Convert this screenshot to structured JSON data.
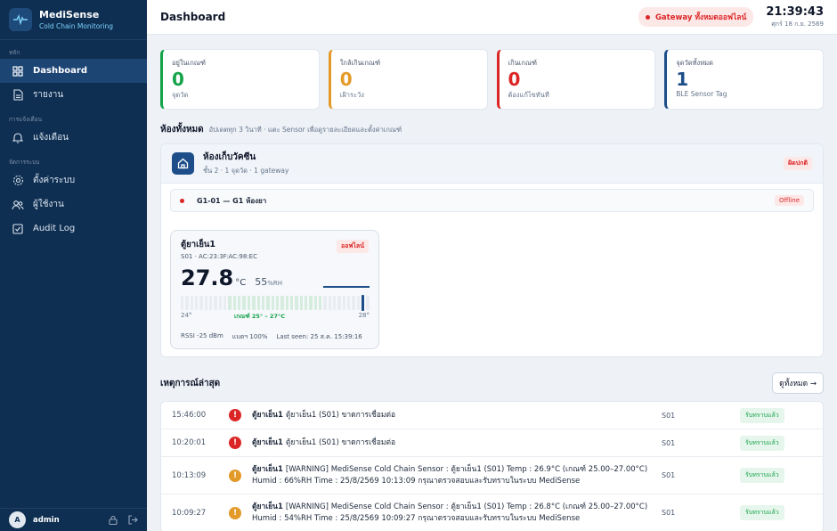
{
  "brand": {
    "name": "MediSense",
    "subtitle": "Cold Chain Monitoring"
  },
  "sidebar": {
    "sections": [
      "หลัก",
      "การแจ้งเตือน",
      "จัดการระบบ"
    ],
    "items": [
      {
        "label": "Dashboard",
        "icon": "grid-icon"
      },
      {
        "label": "รายงาน",
        "icon": "document-icon"
      },
      {
        "label": "แจ้งเตือน",
        "icon": "bell-icon"
      },
      {
        "label": "ตั้งค่าระบบ",
        "icon": "gear-icon"
      },
      {
        "label": "ผู้ใช้งาน",
        "icon": "users-icon"
      },
      {
        "label": "Audit Log",
        "icon": "checkbox-icon"
      }
    ]
  },
  "user": {
    "initial": "A",
    "name": "admin"
  },
  "header": {
    "title": "Dashboard",
    "gateway_status": "Gateway ทั้งหมดออฟไลน์",
    "time": "21:39:43",
    "date": "ศุกร์ 18 ก.ย. 2569"
  },
  "stats": [
    {
      "label": "อยู่ในเกณฑ์",
      "value": "0",
      "sub": "จุดวัด",
      "color": "#16a34a"
    },
    {
      "label": "ใกล้เกินเกณฑ์",
      "value": "0",
      "sub": "เฝ้าระวัง",
      "color": "#e39a29"
    },
    {
      "label": "เกินเกณฑ์",
      "value": "0",
      "sub": "ต้องแก้ไขทันที",
      "color": "#dc2626"
    },
    {
      "label": "จุดวัดทั้งหมด",
      "value": "1",
      "sub": "BLE Sensor Tag",
      "color": "#1d4e89"
    }
  ],
  "rooms_section": {
    "title": "ห้องทั้งหมด",
    "note": "อัปเดตทุก 3 วินาที · แตะ Sensor เพื่อดูรายละเอียดและตั้งค่าเกณฑ์"
  },
  "room": {
    "name": "ห้องเก็บวัคซีน",
    "sub": "ชั้น 2 · 1 จุดวัด · 1 gateway",
    "status": "ผิดปกติ",
    "gateway": {
      "name": "G1-01 — G1 ห้องยา",
      "status": "Offline"
    },
    "sensor": {
      "name": "ตู้ยาเย็น1",
      "id": "S01 · AC:23:3F:AC:98:EC",
      "status": "ออฟไลน์",
      "temp": "27.8",
      "temp_unit": "°C",
      "humidity": "55",
      "humidity_unit": "%RH",
      "range_min": "24°",
      "range_max": "28°",
      "range_label": "เกณฑ์ 25° – 27°C",
      "rssi": "RSSI -25 dBm",
      "battery": "แบตฯ 100%",
      "last_seen": "Last seen: 25 ส.ค. 15:39:16"
    }
  },
  "events_section": {
    "title": "เหตุการณ์ล่าสุด",
    "see_all": "ดูทั้งหมด →"
  },
  "events": [
    {
      "time": "15:46:00",
      "level": "critical",
      "device": "ตู้ยาเย็น1",
      "message": "ตู้ยาเย็น1 (S01) ขาดการเชื่อมต่อ",
      "message2": "",
      "sensor": "S01",
      "status": "รับทราบแล้ว"
    },
    {
      "time": "10:20:01",
      "level": "critical",
      "device": "ตู้ยาเย็น1",
      "message": "ตู้ยาเย็น1 (S01) ขาดการเชื่อมต่อ",
      "message2": "",
      "sensor": "S01",
      "status": "รับทราบแล้ว"
    },
    {
      "time": "10:13:09",
      "level": "warning",
      "device": "ตู้ยาเย็น1",
      "message": "[WARNING] MediSense Cold Chain Sensor : ตู้ยาเย็น1 (S01) Temp : 26.9°C (เกณฑ์ 25.00–27.00°C)",
      "message2": "Humid : 66%RH Time : 25/8/2569 10:13:09 กรุณาตรวจสอบและรับทราบในระบบ MediSense",
      "sensor": "S01",
      "status": "รับทราบแล้ว"
    },
    {
      "time": "10:09:27",
      "level": "warning",
      "device": "ตู้ยาเย็น1",
      "message": "[WARNING] MediSense Cold Chain Sensor : ตู้ยาเย็น1 (S01) Temp : 26.8°C (เกณฑ์ 25.00–27.00°C)",
      "message2": "Humid : 54%RH Time : 25/8/2569 10:09:27 กรุณาตรวจสอบและรับทราบในระบบ MediSense",
      "sensor": "S01",
      "status": "รับทราบแล้ว"
    }
  ]
}
